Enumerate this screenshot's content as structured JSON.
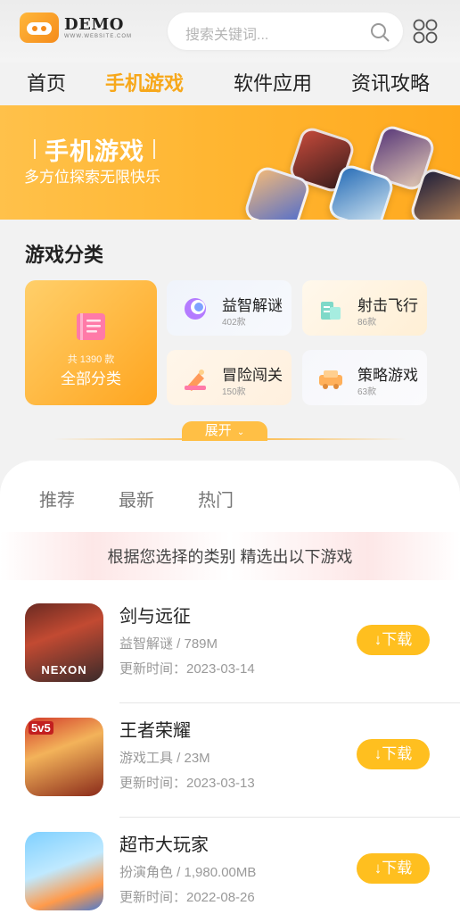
{
  "header": {
    "logo_text": "DEMO",
    "logo_sub": "WWW.WEBSITE.COM",
    "search_placeholder": "搜索关键词..."
  },
  "nav": {
    "items": [
      {
        "label": "首页",
        "active": false
      },
      {
        "label": "手机游戏",
        "active": true
      },
      {
        "label": "软件应用",
        "active": false
      },
      {
        "label": "资讯攻略",
        "active": false
      }
    ]
  },
  "banner": {
    "title": "手机游戏",
    "subtitle": "多方位探索无限快乐"
  },
  "categories": {
    "title": "游戏分类",
    "all": {
      "count": "共 1390 款",
      "label": "全部分类"
    },
    "items": [
      {
        "name": "益智解谜",
        "count": "402款"
      },
      {
        "name": "射击飞行",
        "count": "86款"
      },
      {
        "name": "冒险闯关",
        "count": "150款"
      },
      {
        "name": "策略游戏",
        "count": "63款"
      }
    ],
    "expand_label": "展开"
  },
  "tabs": [
    {
      "label": "推荐"
    },
    {
      "label": "最新"
    },
    {
      "label": "热门"
    }
  ],
  "hint": "根据您选择的类别 精选出以下游戏",
  "games": [
    {
      "name": "剑与远征",
      "meta": "益智解谜 / 789M",
      "date": "更新时间：2023-03-14",
      "button": "↓下载",
      "icon_label": "NEXON"
    },
    {
      "name": "王者荣耀",
      "meta": "游戏工具 / 23M",
      "date": "更新时间：2023-03-13",
      "button": "↓下载",
      "icon_label": "5v5"
    },
    {
      "name": "超市大玩家",
      "meta": "扮演角色 / 1,980.00MB",
      "date": "更新时间：2022-08-26",
      "button": "↓下载",
      "icon_label": ""
    }
  ],
  "colors": {
    "accent": "#f7a81b",
    "banner": "#ffb632",
    "download": "#ffbf1f"
  }
}
